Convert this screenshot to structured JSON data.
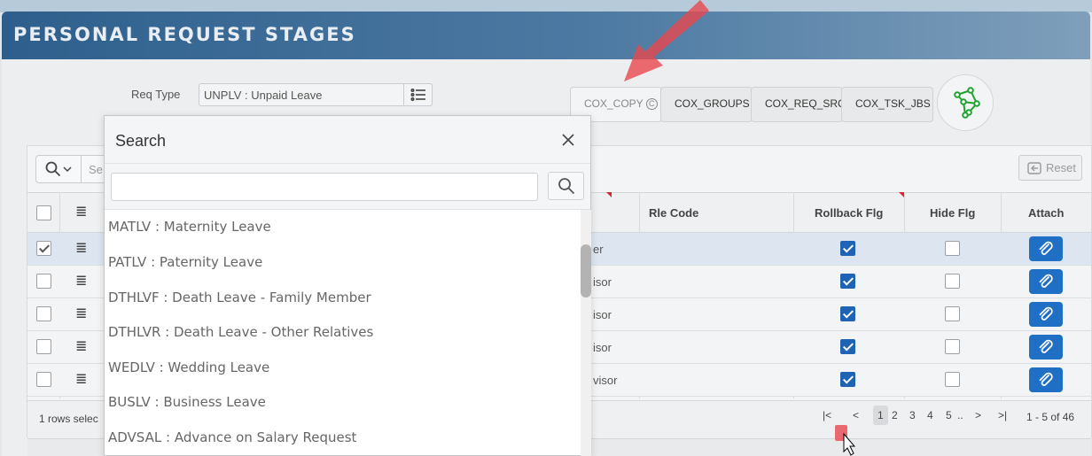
{
  "header": {
    "title": "PERSONAL REQUEST STAGES"
  },
  "form": {
    "req_type_label": "Req Type",
    "req_type_value": "UNPLV  :  Unpaid Leave"
  },
  "tabs": [
    "COX_COPY",
    "COX_GROUPS",
    "COX_REQ_SRC",
    "COX_TSK_JBS"
  ],
  "tab_copy_circle": "C",
  "toolbar": {
    "search_placeholder": "Se",
    "reset_label": "Reset"
  },
  "table": {
    "headers": {
      "rle_code": "Rle Code",
      "rollback_flg": "Rollback Flg",
      "hide_flg": "Hide Flg",
      "attach": "Attach"
    },
    "rows": [
      {
        "desc_tail": "er",
        "selected": true,
        "rollback": true,
        "hide": false
      },
      {
        "desc_tail": "isor",
        "selected": false,
        "rollback": true,
        "hide": false
      },
      {
        "desc_tail": "isor",
        "selected": false,
        "rollback": true,
        "hide": false
      },
      {
        "desc_tail": "isor",
        "selected": false,
        "rollback": true,
        "hide": false
      },
      {
        "desc_tail": "visor",
        "selected": false,
        "rollback": true,
        "hide": false
      }
    ]
  },
  "footer": {
    "selected_text": "1 rows selec",
    "pages": [
      "1",
      "2",
      "3",
      "4",
      "5",
      ".."
    ],
    "active_page": "1",
    "range_text": "1 - 5 of 46"
  },
  "modal": {
    "title": "Search",
    "input_value": "",
    "options": [
      "MATLV : Maternity Leave",
      "PATLV : Paternity Leave",
      "DTHLVF : Death Leave - Family Member",
      "DTHLVR : Death Leave - Other Relatives",
      "WEDLV : Wedding Leave",
      "BUSLV : Business Leave",
      "ADVSAL : Advance on Salary Request"
    ]
  },
  "colors": {
    "accent": "#1f6fc4",
    "header_start": "#2e5f8c",
    "annotation_red": "#e8474e"
  }
}
